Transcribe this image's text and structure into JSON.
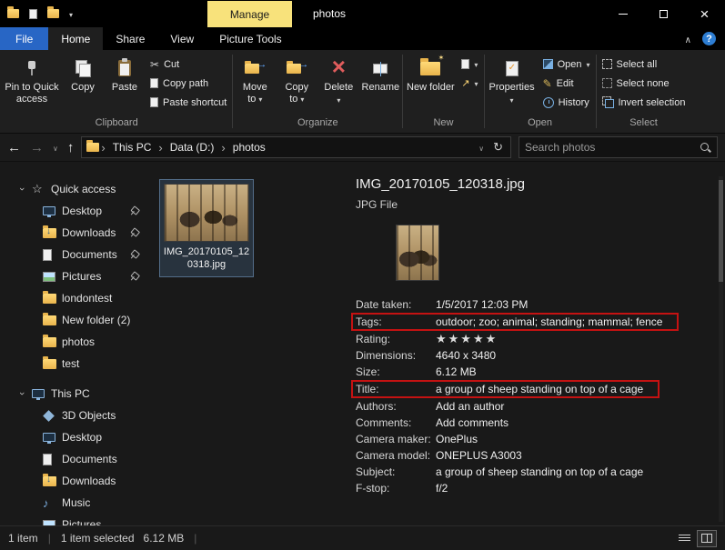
{
  "window": {
    "title": "photos"
  },
  "titlebar": {
    "manage_label": "Manage"
  },
  "tabs": {
    "file": "File",
    "home": "Home",
    "share": "Share",
    "view": "View",
    "picture_tools": "Picture Tools"
  },
  "ribbon": {
    "pin": "Pin to Quick access",
    "copy": "Copy",
    "paste": "Paste",
    "cut": "Cut",
    "copy_path": "Copy path",
    "paste_shortcut": "Paste shortcut",
    "group_clipboard": "Clipboard",
    "move_to": "Move to",
    "copy_to": "Copy to",
    "delete": "Delete",
    "rename": "Rename",
    "group_organize": "Organize",
    "new_folder": "New folder",
    "group_new": "New",
    "properties": "Properties",
    "open": "Open",
    "edit": "Edit",
    "history": "History",
    "group_open": "Open",
    "select_all": "Select all",
    "select_none": "Select none",
    "invert_selection": "Invert selection",
    "group_select": "Select"
  },
  "address": {
    "crumbs": [
      {
        "label": "This PC"
      },
      {
        "label": "Data (D:)"
      },
      {
        "label": "photos"
      }
    ],
    "search_placeholder": "Search photos"
  },
  "sidebar": {
    "items": [
      {
        "label": "Quick access",
        "icon": "star",
        "chevron": true
      },
      {
        "label": "Desktop",
        "icon": "desktop",
        "indent": true,
        "pinned": true
      },
      {
        "label": "Downloads",
        "icon": "downloads",
        "indent": true,
        "pinned": true
      },
      {
        "label": "Documents",
        "icon": "documents",
        "indent": true,
        "pinned": true
      },
      {
        "label": "Pictures",
        "icon": "pictures",
        "indent": true,
        "pinned": true
      },
      {
        "label": "londontest",
        "icon": "folder",
        "indent": true
      },
      {
        "label": "New folder (2)",
        "icon": "folder",
        "indent": true
      },
      {
        "label": "photos",
        "icon": "folder",
        "indent": true
      },
      {
        "label": "test",
        "icon": "folder",
        "indent": true
      },
      {
        "label": "This PC",
        "icon": "pc",
        "chevron": true,
        "gap": true
      },
      {
        "label": "3D Objects",
        "icon": "cube",
        "indent": true
      },
      {
        "label": "Desktop",
        "icon": "desktop",
        "indent": true
      },
      {
        "label": "Documents",
        "icon": "documents",
        "indent": true
      },
      {
        "label": "Downloads",
        "icon": "downloads",
        "indent": true
      },
      {
        "label": "Music",
        "icon": "music",
        "indent": true
      },
      {
        "label": "Pictures",
        "icon": "pictures",
        "indent": true
      }
    ]
  },
  "content": {
    "selected_file_name": "IMG_20170105_120318.jpg"
  },
  "details": {
    "heading": "IMG_20170105_120318.jpg",
    "file_type": "JPG File",
    "properties": [
      {
        "label": "Date taken:",
        "value": "1/5/2017 12:03 PM"
      },
      {
        "label": "Tags:",
        "value": "outdoor; zoo; animal; standing; mammal; fence",
        "highlighted": true
      },
      {
        "label": "Rating:",
        "value": "★★★★★",
        "stars": true
      },
      {
        "label": "Dimensions:",
        "value": "4640 x 3480"
      },
      {
        "label": "Size:",
        "value": "6.12 MB"
      },
      {
        "label": "Title:",
        "value": "a group of sheep standing on top of a cage",
        "highlighted": true
      },
      {
        "label": "Authors:",
        "value": "Add an author"
      },
      {
        "label": "Comments:",
        "value": "Add comments"
      },
      {
        "label": "Camera maker:",
        "value": "OnePlus"
      },
      {
        "label": "Camera model:",
        "value": "ONEPLUS A3003"
      },
      {
        "label": "Subject:",
        "value": "a group of sheep standing on top of a cage"
      },
      {
        "label": "F-stop:",
        "value": "f/2"
      }
    ]
  },
  "statusbar": {
    "item_count": "1 item",
    "selection": "1 item selected",
    "selection_size": "6.12 MB"
  },
  "colors": {
    "manage_tab_bg": "#f8e27b",
    "file_tab_bg": "#2866c5",
    "annotation_red": "#c51212",
    "help_blue": "#2d7dd2",
    "folder_yellow": "#ffd977"
  }
}
